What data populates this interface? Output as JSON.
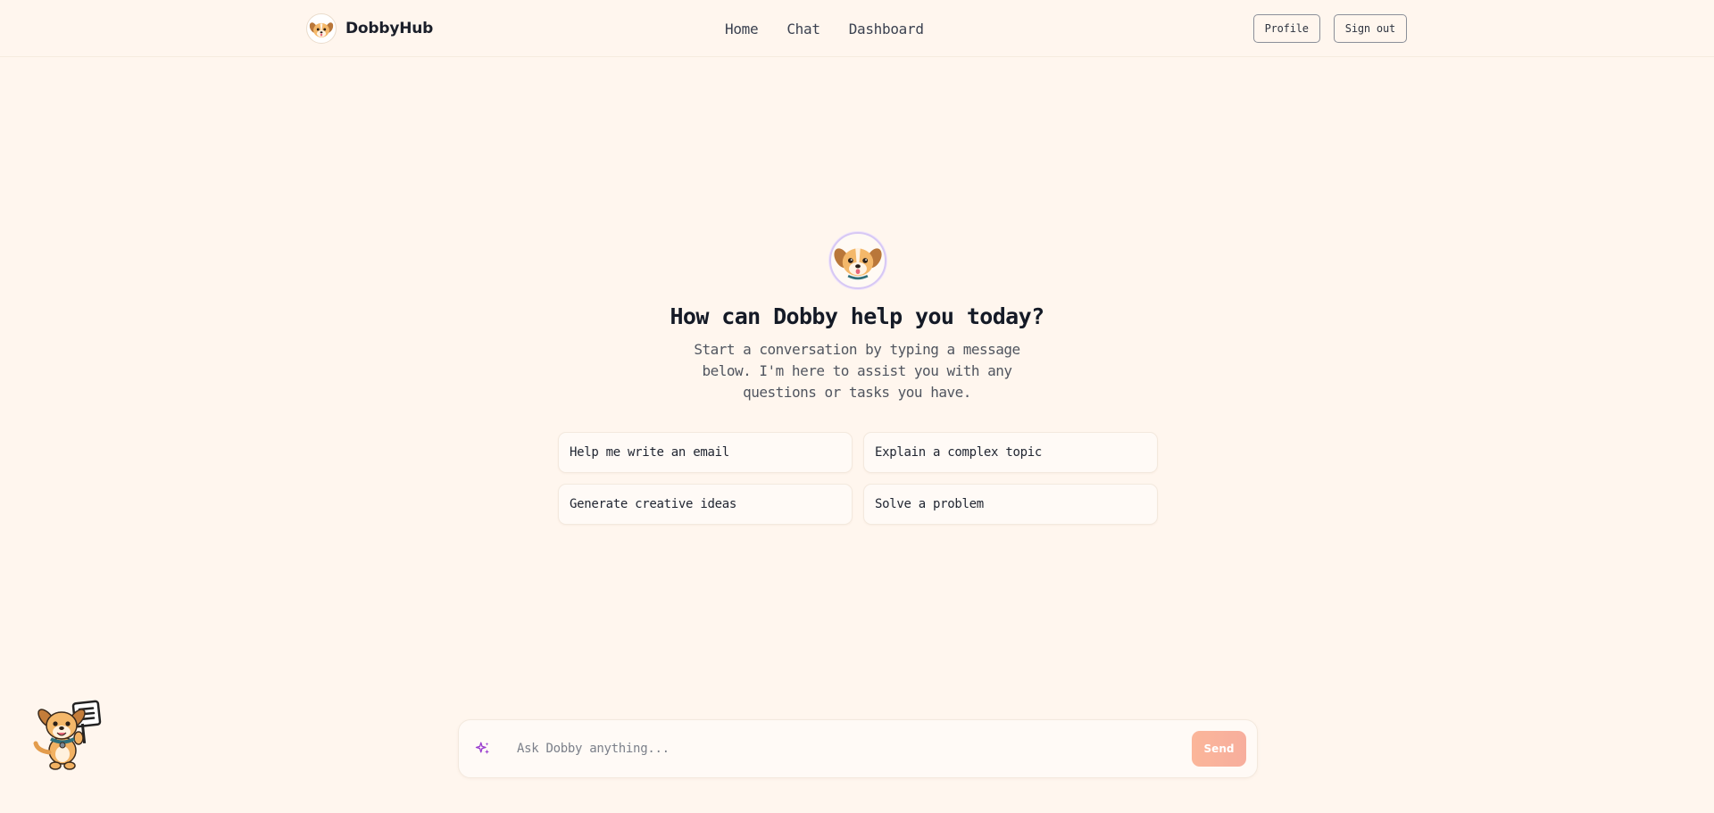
{
  "app": {
    "name": "DobbyHub"
  },
  "nav": {
    "items": [
      {
        "label": "Home"
      },
      {
        "label": "Chat"
      },
      {
        "label": "Dashboard"
      }
    ]
  },
  "header_actions": {
    "profile_label": "Profile",
    "signout_label": "Sign out"
  },
  "hero": {
    "title": "How can Dobby help you today?",
    "subtitle": "Start a conversation by typing a message below. I'm here to assist you with any questions or tasks you have."
  },
  "suggestions": [
    {
      "label": "Help me write an email"
    },
    {
      "label": "Explain a complex topic"
    },
    {
      "label": "Generate creative ideas"
    },
    {
      "label": "Solve a problem"
    }
  ],
  "composer": {
    "placeholder": "Ask Dobby anything...",
    "send_label": "Send"
  },
  "colors": {
    "background": "#fff6ee",
    "accent_send": "#fbb69a",
    "sparkle": "#9b3fcf",
    "avatar_ring": "#d7c8f4"
  },
  "icons": {
    "brand": "dog-face-icon",
    "hero": "dog-face-icon",
    "composer": "sparkles-icon",
    "mascot": "dog-mascot-with-sign-icon"
  }
}
